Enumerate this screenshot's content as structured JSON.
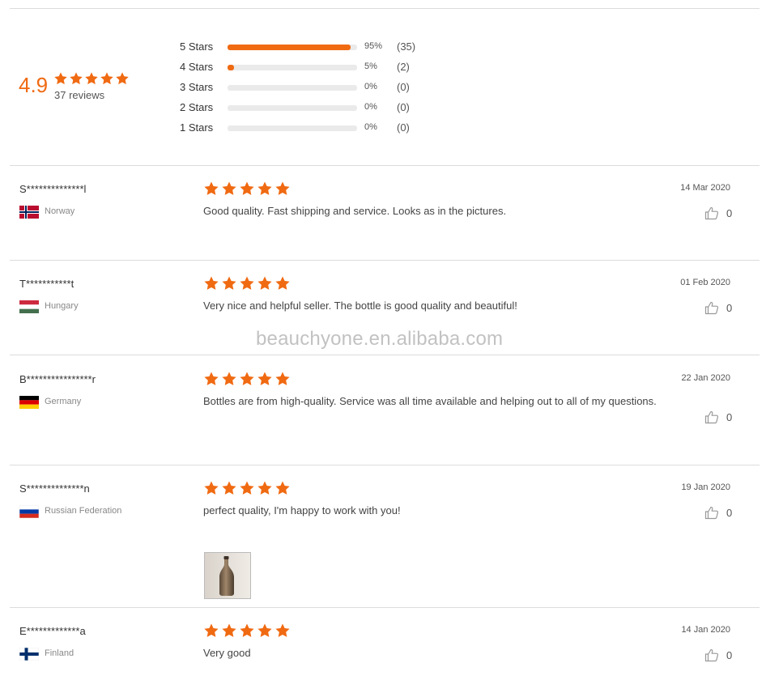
{
  "summary": {
    "score": "4.9",
    "stars": 5,
    "review_count_label": "37 reviews",
    "distribution": [
      {
        "label": "5 Stars",
        "percent": 95,
        "percent_label": "95%",
        "count_label": "(35)"
      },
      {
        "label": "4 Stars",
        "percent": 5,
        "percent_label": "5%",
        "count_label": "(2)"
      },
      {
        "label": "3 Stars",
        "percent": 0,
        "percent_label": "0%",
        "count_label": "(0)"
      },
      {
        "label": "2 Stars",
        "percent": 0,
        "percent_label": "0%",
        "count_label": "(0)"
      },
      {
        "label": "1 Stars",
        "percent": 0,
        "percent_label": "0%",
        "count_label": "(0)"
      }
    ]
  },
  "reviews": [
    {
      "name": "S**************l",
      "country": "Norway",
      "flag": "norway-flag",
      "rating": 5,
      "text": "Good quality. Fast shipping and service. Looks as in the pictures.",
      "date": "14 Mar 2020",
      "likes": "0"
    },
    {
      "name": "T***********t",
      "country": "Hungary",
      "flag": "hungary-flag",
      "rating": 5,
      "text": "Very nice and helpful seller. The bottle is good quality and beautiful!",
      "date": "01 Feb 2020",
      "likes": "0"
    },
    {
      "name": "B****************r",
      "country": "Germany",
      "flag": "germany-flag",
      "rating": 5,
      "text": "Bottles are from high-quality. Service was all time available and helping out to all of my questions.",
      "date": "22 Jan 2020",
      "likes": "0"
    },
    {
      "name": "S**************n",
      "country": "Russian Federation",
      "flag": "russia-flag",
      "rating": 5,
      "text": "perfect quality, I'm happy to work with you!",
      "date": "19 Jan 2020",
      "likes": "0",
      "photo": "bottle-photo"
    },
    {
      "name": "E*************a",
      "country": "Finland",
      "flag": "finland-flag",
      "rating": 5,
      "text": "Very good",
      "date": "14 Jan 2020",
      "likes": "0"
    }
  ],
  "watermark": "beauchyone.en.alibaba.com",
  "colors": {
    "accent": "#f06a12",
    "track": "#eaeaea",
    "divider": "#dcdcdc"
  },
  "icons": {
    "star": "star-icon",
    "like": "thumbs-up-icon"
  }
}
